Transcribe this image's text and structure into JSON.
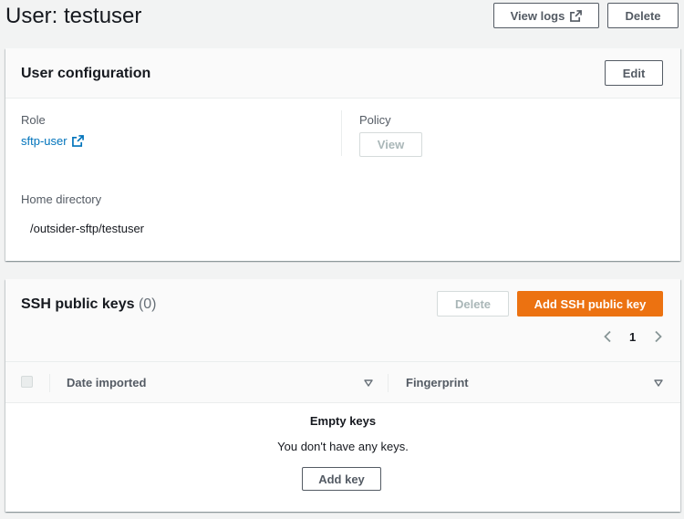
{
  "header": {
    "title": "User: testuser",
    "view_logs_label": "View logs",
    "delete_label": "Delete"
  },
  "user_config": {
    "title": "User configuration",
    "edit_label": "Edit",
    "role_label": "Role",
    "role_value": "sftp-user",
    "policy_label": "Policy",
    "policy_view_label": "View",
    "home_dir_label": "Home directory",
    "home_dir_value": "/outsider-sftp/testuser"
  },
  "ssh_keys": {
    "title": "SSH public keys",
    "count": "(0)",
    "delete_label": "Delete",
    "add_label": "Add SSH public key",
    "pagination": {
      "current_page": "1"
    },
    "columns": [
      "Date imported",
      "Fingerprint"
    ],
    "empty_title": "Empty keys",
    "empty_message": "You don't have any keys.",
    "add_key_label": "Add key"
  },
  "colors": {
    "primary": "#ec7211",
    "link": "#0073bb",
    "background": "#f2f3f3"
  }
}
